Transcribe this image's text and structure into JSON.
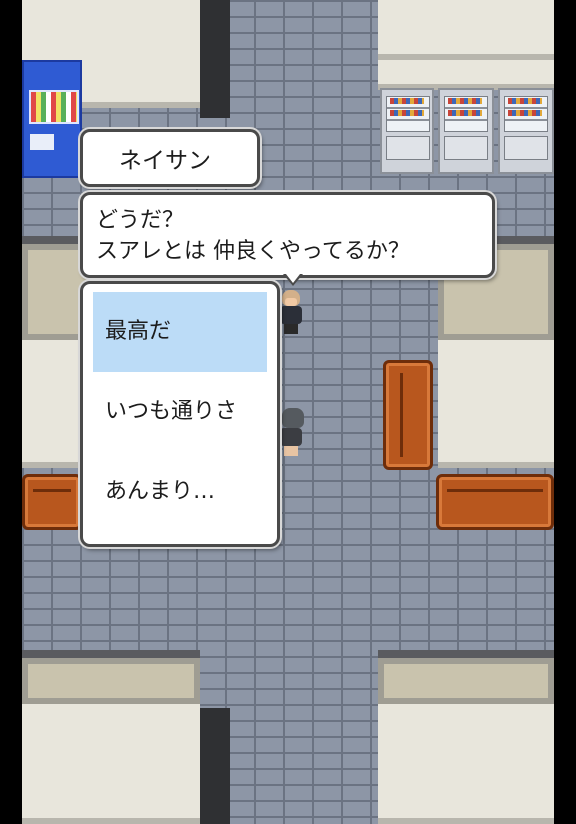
{
  "dialog": {
    "speaker": "ネイサン",
    "lines": [
      "どうだ？",
      "スアレとは 仲良くやってるか？"
    ]
  },
  "choices": {
    "selected_index": 0,
    "items": [
      "最高だ",
      "いつも通りさ",
      "あんまり…"
    ]
  },
  "colors": {
    "selection_highlight": "#bcdcf7",
    "window_border": "#4a4a4a",
    "floor": "#8d96a6",
    "sofa": "#b8571e"
  }
}
